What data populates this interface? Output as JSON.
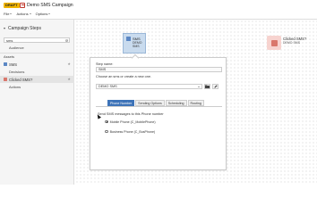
{
  "header": {
    "status_badge": "DRAFT",
    "campaign_name": "Demo SMS Campaign",
    "menu": {
      "file": "File",
      "actions": "Actions",
      "options": "Options"
    }
  },
  "sidebar": {
    "title": "Campaign Steps",
    "search": {
      "value": "sms",
      "placeholder": ""
    },
    "audience_label": "Audience",
    "assets_label": "Assets",
    "sms_step": {
      "label": "SMS",
      "color": "#5b87c4"
    },
    "decisions_label": "Decisions",
    "clicked_step": {
      "label": "Clicked SMS?",
      "color": "#d9776c"
    },
    "actions_label": "Actions"
  },
  "canvas": {
    "sms_node": {
      "title": "SMS",
      "subtitle": "DEMO SMS"
    },
    "clicked_node": {
      "title": "Clicked SMS?",
      "subtitle": "DEMO SMS"
    }
  },
  "panel": {
    "step_name_label": "Step name:",
    "step_name_value": "SMS",
    "choose_label": "Choose an sms or create a new one.",
    "sms_select_value": "DEMO SMS",
    "tabs": [
      "Phone Number",
      "Sending Options",
      "Scheduling",
      "Routing"
    ],
    "send_label": "Send SMS messages to this Phone number",
    "options": [
      {
        "label": "Mobile Phone (C_MobilePhone)",
        "selected": true
      },
      {
        "label": "Business Phone (C_BusPhone)",
        "selected": false
      }
    ]
  },
  "colors": {
    "accent": "#3d73b8",
    "draft_badge": "#f0b400"
  }
}
